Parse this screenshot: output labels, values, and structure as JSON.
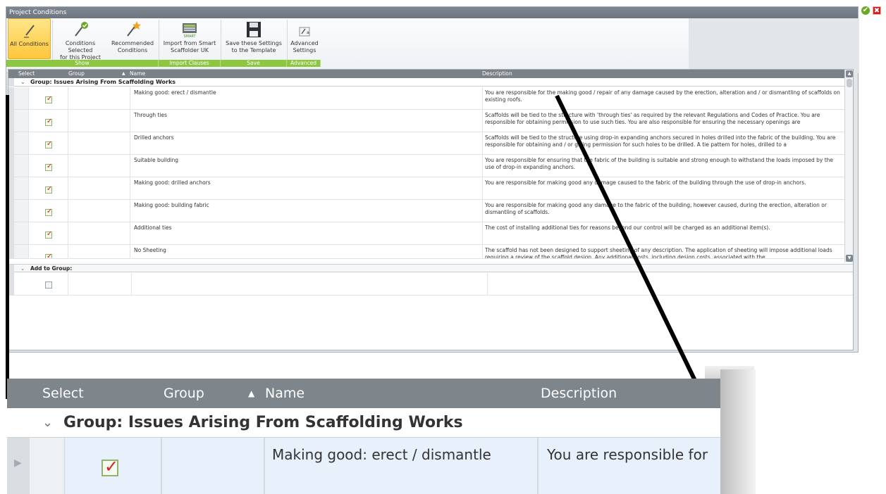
{
  "window": {
    "title": "Project Conditions"
  },
  "corner_icons": {
    "ok_icon": "✔",
    "close_icon": "✖"
  },
  "ribbon": {
    "buttons": [
      {
        "label1": "All Conditions",
        "label2": ""
      },
      {
        "label1": "Conditions Selected",
        "label2": "for this Project"
      },
      {
        "label1": "Recommended",
        "label2": "Conditions"
      },
      {
        "label1": "Import from Smart",
        "label2": "Scaffolder UK"
      },
      {
        "label1": "Save these Settings",
        "label2": "to the Template"
      },
      {
        "label1": "Advanced",
        "label2": "Settings"
      }
    ],
    "groups": [
      "Show",
      "Import Clauses",
      "Save",
      "Advanced"
    ],
    "smart_logo_text": "SMART"
  },
  "grid": {
    "columns": {
      "select": "Select",
      "group": "Group",
      "name": "Name",
      "description": "Description"
    },
    "group_label": "Group: Issues Arising From Scaffolding Works",
    "rows": [
      {
        "name": "Making good: erect / dismantle",
        "description": "You are responsible for the making good / repair of any damage caused by the erection, alteration and / or dismantling of scaffolds on existing roofs.",
        "checked": true
      },
      {
        "name": "Through ties",
        "description": "Scaffolds will be tied to the structure with 'through ties' as required by the relevant Regulations and Codes of Practice. You are responsible for obtaining permission to use such ties. You are also responsible for ensuring the necessary openings are",
        "checked": true
      },
      {
        "name": "Drilled anchors",
        "description": "Scaffolds will be tied to the structure using drop-in expanding anchors secured in holes drilled into the fabric of the building. You are responsible for obtaining and / or giving permission for such holes to be drilled. A tie pattern for holes, drilled to a",
        "checked": true
      },
      {
        "name": "Suitable building",
        "description": "You are responsible for ensuring that the fabric of the building is suitable and strong enough to withstand the loads imposed by the use of drop-in expanding anchors.",
        "checked": true
      },
      {
        "name": "Making good: drilled anchors",
        "description": "You are responsible for making good any damage caused to the fabric of the building through the use of drop-in anchors.",
        "checked": true
      },
      {
        "name": "Making good: building fabric",
        "description": " You are responsible for making good any damage to the fabric of the building, however caused, during the erection, alteration or dismantling of scaffolds.",
        "checked": true
      },
      {
        "name": "Additional ties",
        "description": "The cost of installing additional ties for reasons beyond our control will be charged as an additional item(s).",
        "checked": true
      },
      {
        "name": "No Sheeting",
        "description": "The scaffold has not been designed to support sheeting of any description. The application of sheeting will impose additional loads requiring a review of the scaffold design. Any additional costs, including design costs, associated with the",
        "checked": true
      }
    ],
    "add_group_label": "Add to Group:"
  },
  "zoom": {
    "columns": {
      "select": "Select",
      "group": "Group",
      "name": "Name",
      "description": "Description"
    },
    "group_label": "Group: Issues Arising From Scaffolding Works",
    "row": {
      "name": "Making good: erect / dismantle",
      "description": "You are responsible for"
    }
  }
}
